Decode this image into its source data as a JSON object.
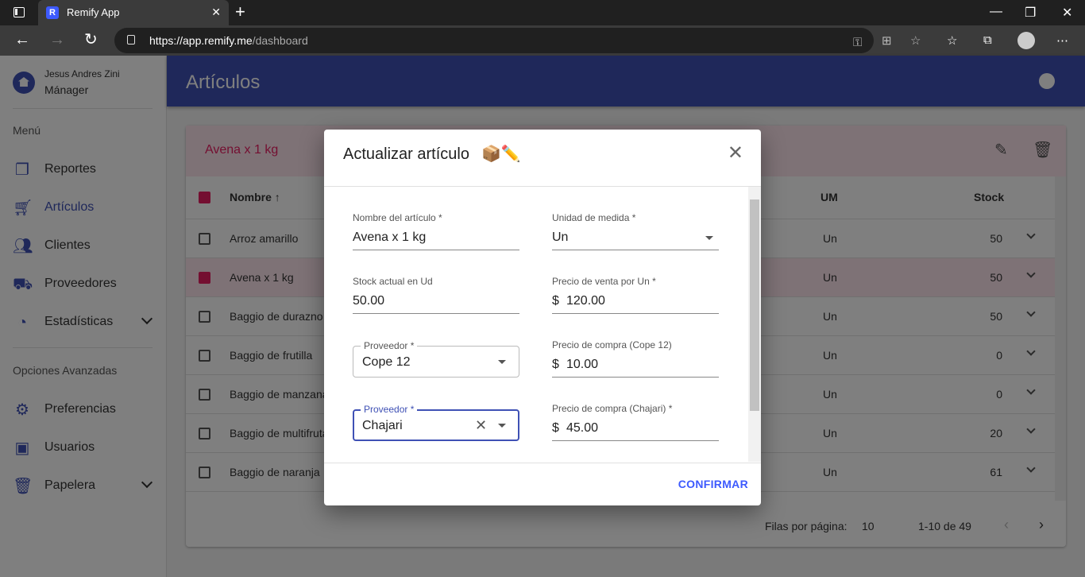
{
  "browser": {
    "tab_title": "Remify App",
    "url_host": "https://app.remify.me",
    "url_path": "/dashboard"
  },
  "sidebar": {
    "user_name": "Jesus Andres Zini",
    "user_role": "Mánager",
    "menu_header": "Menú",
    "items": [
      {
        "label": "Reportes",
        "icon": "file-copy-icon"
      },
      {
        "label": "Artículos",
        "icon": "cart-icon"
      },
      {
        "label": "Clientes",
        "icon": "people-icon"
      },
      {
        "label": "Proveedores",
        "icon": "truck-icon"
      },
      {
        "label": "Estadísticas",
        "icon": "donut-chart-icon"
      }
    ],
    "advanced_header": "Opciones Avanzadas",
    "advanced_items": [
      {
        "label": "Preferencias",
        "icon": "gear-box-icon"
      },
      {
        "label": "Usuarios",
        "icon": "account-box-icon"
      },
      {
        "label": "Papelera",
        "icon": "trash-icon"
      }
    ]
  },
  "appbar": {
    "title": "Artículos"
  },
  "table": {
    "selected_title": "Avena x 1 kg",
    "columns": {
      "name": "Nombre",
      "um": "UM",
      "stock": "Stock"
    },
    "rows": [
      {
        "name": "Arroz amarillo",
        "um": "Un",
        "stock": "50",
        "selected": false
      },
      {
        "name": "Avena x 1 kg",
        "um": "Un",
        "stock": "50",
        "selected": true
      },
      {
        "name": "Baggio de durazno",
        "um": "Un",
        "stock": "50",
        "selected": false
      },
      {
        "name": "Baggio de frutilla",
        "um": "Un",
        "stock": "0",
        "selected": false
      },
      {
        "name": "Baggio de manzana",
        "um": "Un",
        "stock": "0",
        "selected": false
      },
      {
        "name": "Baggio de multifruta",
        "um": "Un",
        "stock": "20",
        "selected": false
      },
      {
        "name": "Baggio de naranja",
        "um": "Un",
        "stock": "61",
        "selected": false
      }
    ],
    "rows_per_page_label": "Filas por página:",
    "rows_per_page": "10",
    "range": "1-10 de 49"
  },
  "dialog": {
    "title": "Actualizar artículo",
    "emoji": "📦✏️",
    "fields": {
      "name_label": "Nombre del artículo *",
      "name_value": "Avena x 1 kg",
      "unit_label": "Unidad de medida *",
      "unit_value": "Un",
      "stock_label": "Stock actual en Ud",
      "stock_value": "50.00",
      "sale_price_label": "Precio de venta por Un *",
      "currency": "$",
      "sale_price_value": "120.00",
      "supplier1_label": "Proveedor *",
      "supplier1_value": "Cope 12",
      "buy_price1_label": "Precio de compra (Cope 12)",
      "buy_price1_value": "10.00",
      "supplier2_label": "Proveedor *",
      "supplier2_value": "Chajari",
      "buy_price2_label": "Precio de compra (Chajari) *",
      "buy_price2_value": "45.00"
    },
    "confirm_label": "CONFIRMAR"
  },
  "colors": {
    "primary": "#3f51b5",
    "accent": "#e91e63",
    "link": "#3d5afe"
  }
}
